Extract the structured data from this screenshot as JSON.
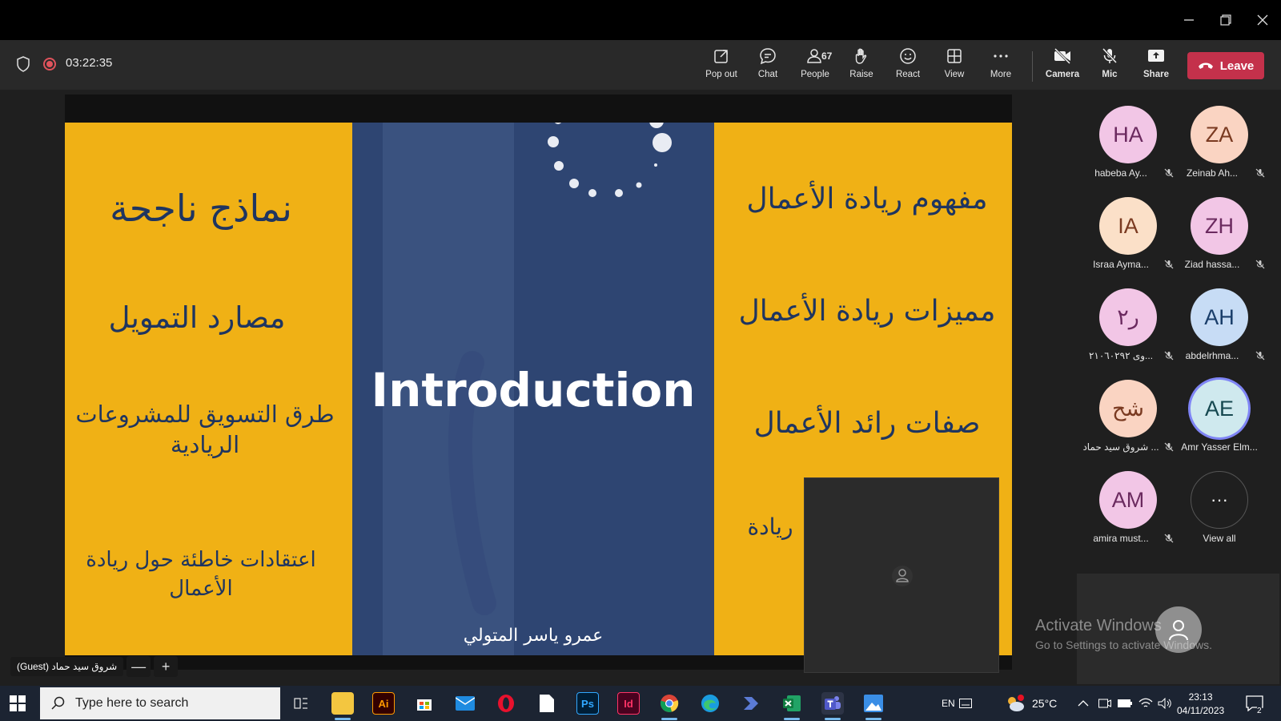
{
  "topbar": {
    "timer": "03:22:35",
    "buttons": {
      "popout": "Pop out",
      "chat": "Chat",
      "people": "People",
      "people_count": "67",
      "raise": "Raise",
      "react": "React",
      "view": "View",
      "more": "More",
      "camera": "Camera",
      "mic": "Mic",
      "share": "Share",
      "leave": "Leave"
    }
  },
  "slide": {
    "left": {
      "item1": "نماذج ناجحة",
      "item2": "مصارد التمويل",
      "item3": "طرق التسويق للمشروعات الريادية",
      "item4": "اعتقادات خاطئة  حول ريادة الأعمال"
    },
    "center": {
      "title": "Introduction",
      "author": "عمرو ياسر المتولي"
    },
    "right": {
      "item1": "مفهوم ريادة الأعمال",
      "item2": "مميزات ريادة الأعمال",
      "item3": "صفات رائد الأعمال",
      "item4": "ريادة"
    }
  },
  "guest_bar": {
    "name": "شروق سيد حماد (Guest)",
    "zoom_out": "—",
    "zoom_in": "+"
  },
  "roster": [
    {
      "initials": "HA",
      "name": "habeba Ay..."
    },
    {
      "initials": "ZA",
      "name": "Zeinab Ah..."
    },
    {
      "initials": "IA",
      "name": "Israa Ayma..."
    },
    {
      "initials": "ZH",
      "name": "Ziad hassa..."
    },
    {
      "initials": "ر٢",
      "name": "...وى ٢١٠٦٠٢٩٢"
    },
    {
      "initials": "AH",
      "name": "abdelrhma..."
    },
    {
      "initials": "شح",
      "name": "... شروق سيد حماد"
    },
    {
      "initials": "AE",
      "name": "Amr Yasser Elm..."
    },
    {
      "initials": "AM",
      "name": "amira must..."
    },
    {
      "initials": "···",
      "name": "View all"
    }
  ],
  "watermark": {
    "line1": "Activate Windows",
    "line2": "Go to Settings to activate Windows."
  },
  "taskbar": {
    "search_placeholder": "Type here to search",
    "apps": [
      "Ai",
      "Ps",
      "Id"
    ],
    "lang": "EN",
    "weather": "25°C",
    "time": "23:13",
    "date": "04/11/2023",
    "notif_count": "2"
  },
  "colors": {
    "slide_yellow": "#f0b115",
    "slide_navy": "#2e4572",
    "leave_red": "#c4314b",
    "topbar_bg": "#292929"
  }
}
